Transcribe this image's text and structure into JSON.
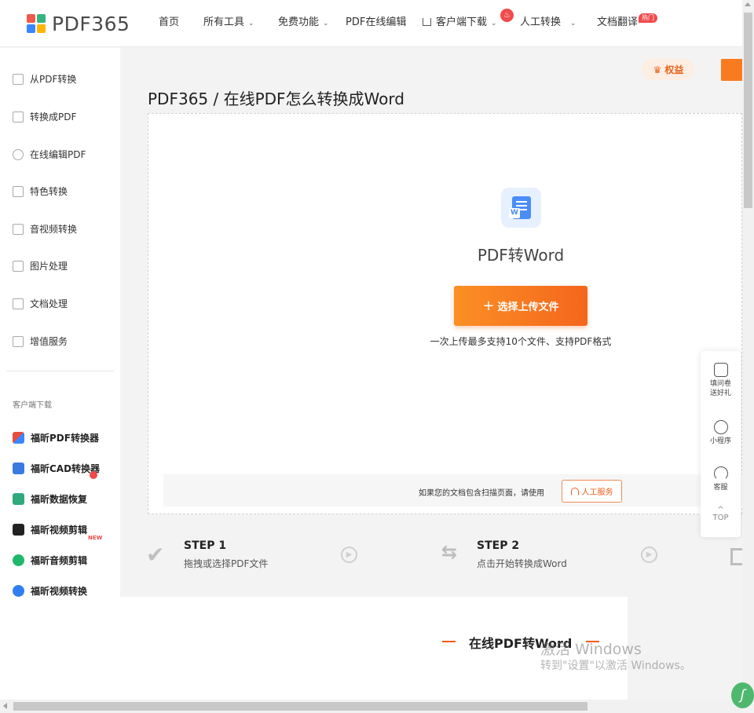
{
  "header": {
    "logo_text": "PDF365",
    "nav": [
      {
        "label": "首页",
        "has_dropdown": false
      },
      {
        "label": "所有工具",
        "has_dropdown": true
      },
      {
        "label": "免费功能",
        "has_dropdown": true
      },
      {
        "label": "PDF在线编辑",
        "has_dropdown": false
      },
      {
        "label": "客户端下载",
        "has_dropdown": true
      },
      {
        "label": "人工转换",
        "has_dropdown": true
      },
      {
        "label": "文档翻译",
        "has_dropdown": false
      }
    ],
    "hot_tag": "热门"
  },
  "sidebar": {
    "categories": [
      {
        "label": "从PDF转换",
        "icon": "from-pdf-icon"
      },
      {
        "label": "转换成PDF",
        "icon": "to-pdf-icon"
      },
      {
        "label": "在线编辑PDF",
        "icon": "edit-pdf-icon"
      },
      {
        "label": "特色转换",
        "icon": "special-convert-icon"
      },
      {
        "label": "音视频转换",
        "icon": "av-convert-icon"
      },
      {
        "label": "图片处理",
        "icon": "image-icon"
      },
      {
        "label": "文档处理",
        "icon": "document-icon"
      },
      {
        "label": "增值服务",
        "icon": "service-icon"
      }
    ],
    "download_heading": "客户端下载",
    "apps": [
      {
        "label": "福昕PDF转换器",
        "color": "#e84c3d"
      },
      {
        "label": "福昕CAD转换器",
        "color": "#3a7be0"
      },
      {
        "label": "福昕数据恢复",
        "color": "#2eaa7d"
      },
      {
        "label": "福昕视频剪辑",
        "color": "#222222"
      },
      {
        "label": "福昕音频剪辑",
        "color": "#1fb86a"
      },
      {
        "label": "福昕视频转换",
        "color": "#2f7ff0"
      }
    ],
    "new_badge": "NEW"
  },
  "main": {
    "quanyi_label": "权益",
    "page_title": "PDF365 / 在线PDF怎么转换成Word",
    "tool_name": "PDF转Word",
    "upload_button": "选择上传文件",
    "upload_hint": "一次上传最多支持10个文件、支持PDF格式",
    "scan_text": "如果您的文档包含扫描页面，请使用",
    "service_button": "人工服务",
    "steps": [
      {
        "title": "STEP 1",
        "desc": "拖拽或选择PDF文件"
      },
      {
        "title": "STEP 2",
        "desc": "点击开始转换成Word"
      }
    ],
    "section_title": "在线PDF转Word"
  },
  "float_panel": {
    "items": [
      {
        "label_line1": "填问卷",
        "label_line2": "送好礼"
      },
      {
        "label_line1": "小程序",
        "label_line2": ""
      },
      {
        "label_line1": "客服",
        "label_line2": ""
      }
    ],
    "top_label": "TOP"
  },
  "watermark": {
    "line1": "激活 Windows",
    "line2": "转到\"设置\"以激活 Windows。"
  },
  "colors": {
    "accent": "#f4661c",
    "brand_blue": "#4b8df7"
  }
}
